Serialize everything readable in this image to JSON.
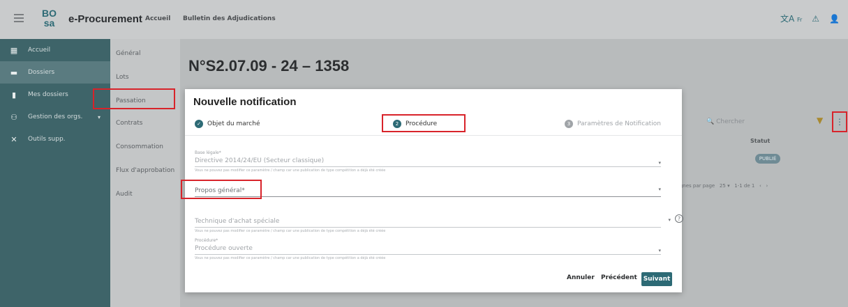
{
  "header": {
    "logo_top": "BO",
    "logo_bottom": "SA",
    "app_title": "e-Procurement",
    "nav_links": [
      "Accueil",
      "Bulletin des Adjudications"
    ],
    "lang_label": "Fr"
  },
  "sidebar": {
    "items": [
      {
        "label": "Accueil",
        "icon": "dashboard-icon"
      },
      {
        "label": "Dossiers",
        "icon": "folder-icon"
      },
      {
        "label": "Mes dossiers",
        "icon": "bookmark-icon"
      },
      {
        "label": "Gestion des orgs.",
        "icon": "organization-icon"
      },
      {
        "label": "Outils supp.",
        "icon": "tools-icon"
      }
    ]
  },
  "subnav": {
    "items": [
      "Général",
      "Lots",
      "Passation",
      "Contrats",
      "Consommation",
      "Flux d'approbation",
      "Audit"
    ]
  },
  "page": {
    "title": "N°S2.07.09 - 24 – 1358",
    "search_placeholder": "Chercher",
    "column_header": "Statut",
    "status_badge": "PUBLIÉ",
    "pager_rows_label": "Lignes par page",
    "pager_rows_value": "25",
    "pager_range": "1-1 de 1"
  },
  "modal": {
    "title": "Nouvelle notification",
    "steps": [
      {
        "label": "Objet du marché",
        "state": "done"
      },
      {
        "label": "Procédure",
        "state": "current",
        "number": "2"
      },
      {
        "label": "Paramètres de Notification",
        "state": "todo",
        "number": "3"
      }
    ],
    "fields": {
      "legal_basis_label": "Base légale*",
      "legal_basis_value": "Directive 2014/24/EU (Secteur classique)",
      "legal_basis_hint": "Vous ne pouvez pas modifier ce paramètre / champ car une publication de type compétition a déjà été créée",
      "general_purpose_label": "Propos général*",
      "special_technique_label": "Technique d'achat spéciale",
      "special_technique_hint": "Vous ne pouvez pas modifier ce paramètre / champ car une publication de type compétition a déjà été créée",
      "procedure_label": "Procédure*",
      "procedure_value": "Procédure ouverte",
      "procedure_hint": "Vous ne pouvez pas modifier ce paramètre / champ car une publication de type compétition a déjà été créée"
    },
    "buttons": {
      "cancel": "Annuler",
      "previous": "Précédent",
      "next": "Suivant"
    }
  },
  "colors": {
    "accent": "#2d6a75",
    "highlight": "#d8232a",
    "sidebar_bg": "#3e6469"
  }
}
